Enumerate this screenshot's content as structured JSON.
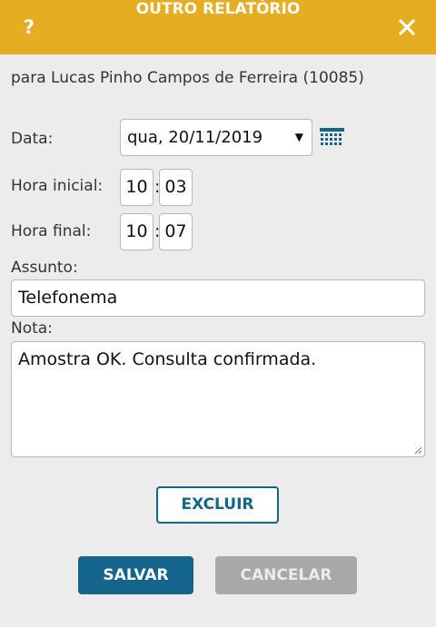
{
  "dialog": {
    "title": "OUTRO RELATÓRIO",
    "help_label": "?",
    "patient_line": "para Lucas Pinho Campos de Ferreira (10085)"
  },
  "form": {
    "date_label": "Data:",
    "date_value": "qua, 20/11/2019",
    "start_label": "Hora inicial:",
    "start_hour": "10",
    "start_minute": "03",
    "end_label": "Hora final:",
    "end_hour": "10",
    "end_minute": "07",
    "time_separator": ":",
    "subject_label": "Assunto:",
    "subject_value": "Telefonema",
    "note_label": "Nota:",
    "note_value": "Amostra OK. Consulta confirmada."
  },
  "buttons": {
    "delete": "EXCLUIR",
    "save": "SALVAR",
    "cancel": "CANCELAR"
  },
  "icons": {
    "help": "help-icon",
    "close": "close-icon",
    "calendar": "calendar-icon",
    "dropdown": "chevron-down-icon"
  },
  "colors": {
    "header": "#e6ad22",
    "primary": "#14648c",
    "disabled": "#a8a8a8",
    "background": "#ececec"
  }
}
